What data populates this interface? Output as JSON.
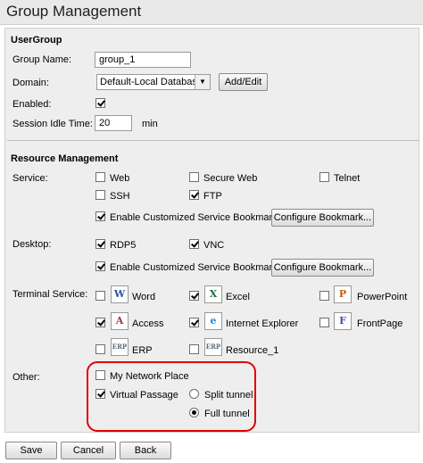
{
  "page": {
    "title": "Group Management"
  },
  "usergroup": {
    "heading": "UserGroup",
    "group_name_label": "Group Name:",
    "group_name_value": "group_1",
    "domain_label": "Domain:",
    "domain_value": "Default-Local Database",
    "add_edit_label": "Add/Edit",
    "enabled_label": "Enabled:",
    "enabled_checked": true,
    "idle_label": "Session Idle Time:",
    "idle_value": "20",
    "idle_unit": "min"
  },
  "resource": {
    "heading": "Resource Management",
    "service_label": "Service:",
    "services": [
      {
        "label": "Web",
        "checked": false
      },
      {
        "label": "Secure Web",
        "checked": false
      },
      {
        "label": "Telnet",
        "checked": false
      },
      {
        "label": "SSH",
        "checked": false
      },
      {
        "label": "FTP",
        "checked": true
      }
    ],
    "service_bookmark_label": "Enable Customized Service Bookmark",
    "service_bookmark_checked": true,
    "configure_bookmark_label": "Configure Bookmark...",
    "desktop_label": "Desktop:",
    "desktops": [
      {
        "label": "RDP5",
        "checked": true
      },
      {
        "label": "VNC",
        "checked": true
      }
    ],
    "desktop_bookmark_label": "Enable Customized Service Bookmark",
    "desktop_bookmark_checked": true,
    "configure_bookmark_label_2": "Configure Bookmark...",
    "terminal_label": "Terminal Service:",
    "terminal": [
      {
        "label": "Word",
        "checked": false,
        "icon": "word-icon",
        "glyph": "W",
        "color": "#2b579a"
      },
      {
        "label": "Excel",
        "checked": true,
        "icon": "excel-icon",
        "glyph": "X",
        "color": "#1e7145"
      },
      {
        "label": "PowerPoint",
        "checked": false,
        "icon": "powerpoint-icon",
        "glyph": "P",
        "color": "#c55a11"
      },
      {
        "label": "Access",
        "checked": true,
        "icon": "access-icon",
        "glyph": "A",
        "color": "#a4373a"
      },
      {
        "label": "Internet Explorer",
        "checked": true,
        "icon": "internet-explorer-icon",
        "glyph": "e",
        "color": "#1e88e5"
      },
      {
        "label": "FrontPage",
        "checked": false,
        "icon": "frontpage-icon",
        "glyph": "F",
        "color": "#3f51b5"
      },
      {
        "label": "ERP",
        "checked": false,
        "icon": "erp-icon",
        "glyph": "ERP",
        "color": "#546e7a"
      },
      {
        "label": "Resource_1",
        "checked": false,
        "icon": "resource-icon",
        "glyph": "ERP",
        "color": "#546e7a"
      }
    ],
    "other_label": "Other:",
    "my_network_place_label": "My Network Place",
    "my_network_place_checked": false,
    "virtual_passage_label": "Virtual Passage",
    "virtual_passage_checked": true,
    "split_tunnel_label": "Split tunnel",
    "full_tunnel_label": "Full tunnel",
    "tunnel_selected": "Full tunnel",
    "highlight_color": "#e00000"
  },
  "footer": {
    "save_label": "Save",
    "cancel_label": "Cancel",
    "back_label": "Back"
  }
}
